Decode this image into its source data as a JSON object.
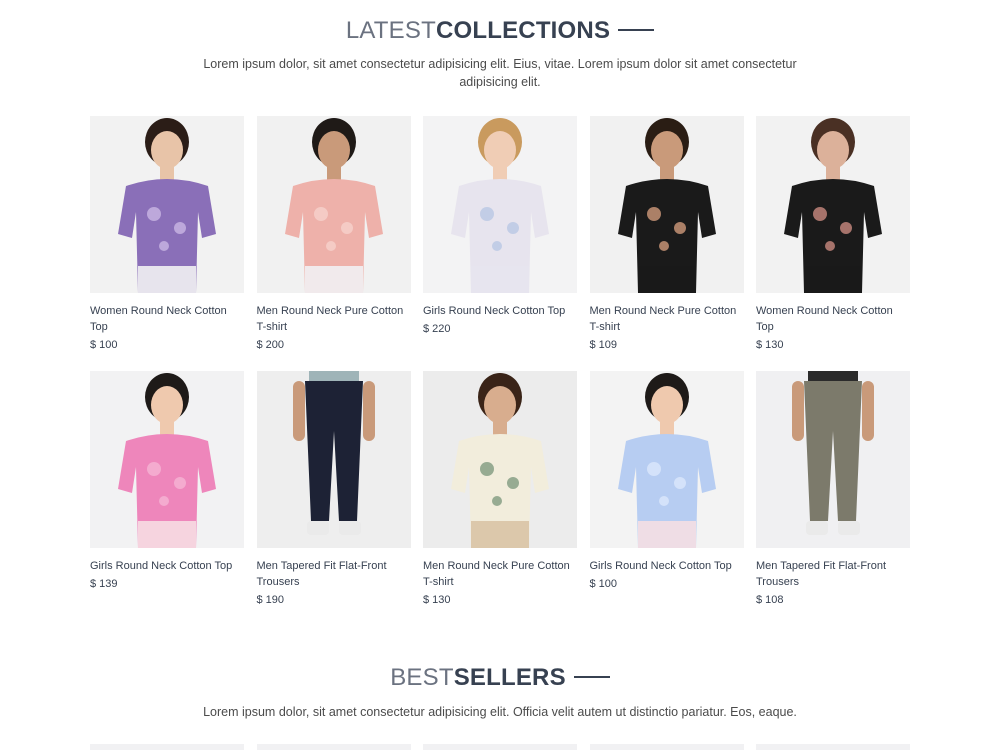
{
  "latest": {
    "title_light": "LATEST",
    "title_bold": "COLLECTIONS",
    "description": "Lorem ipsum dolor, sit amet consectetur adipisicing elit. Eius, vitae. Lorem ipsum dolor sit amet consectetur adipisicing elit.",
    "products": [
      {
        "name": "Women Round Neck Cotton Top",
        "price": "$ 100",
        "image": "woman-floral-top"
      },
      {
        "name": "Men Round Neck Pure Cotton T-shirt",
        "price": "$ 200",
        "image": "man-pink-tshirt"
      },
      {
        "name": "Girls Round Neck Cotton Top",
        "price": "$ 220",
        "image": "girl-floral-dress"
      },
      {
        "name": "Men Round Neck Pure Cotton T-shirt",
        "price": "$ 109",
        "image": "man-black-tshirt"
      },
      {
        "name": "Women Round Neck Cotton Top",
        "price": "$ 130",
        "image": "woman-black-tshirt"
      },
      {
        "name": "Girls Round Neck Cotton Top",
        "price": "$ 139",
        "image": "girl-pink-top"
      },
      {
        "name": "Men Tapered Fit Flat-Front Trousers",
        "price": "$ 190",
        "image": "man-navy-trousers"
      },
      {
        "name": "Men Round Neck Pure Cotton T-shirt",
        "price": "$ 130",
        "image": "man-striped-sweatshirt"
      },
      {
        "name": "Girls Round Neck Cotton Top",
        "price": "$ 100",
        "image": "girl-blue-top"
      },
      {
        "name": "Men Tapered Fit Flat-Front Trousers",
        "price": "$ 108",
        "image": "man-grey-cargo"
      }
    ]
  },
  "bestsellers": {
    "title_light": "BEST",
    "title_bold": "SELLERS",
    "description": "Lorem ipsum dolor, sit amet consectetur adipisicing elit. Officia velit autem ut distinctio pariatur. Eos, eaque."
  }
}
